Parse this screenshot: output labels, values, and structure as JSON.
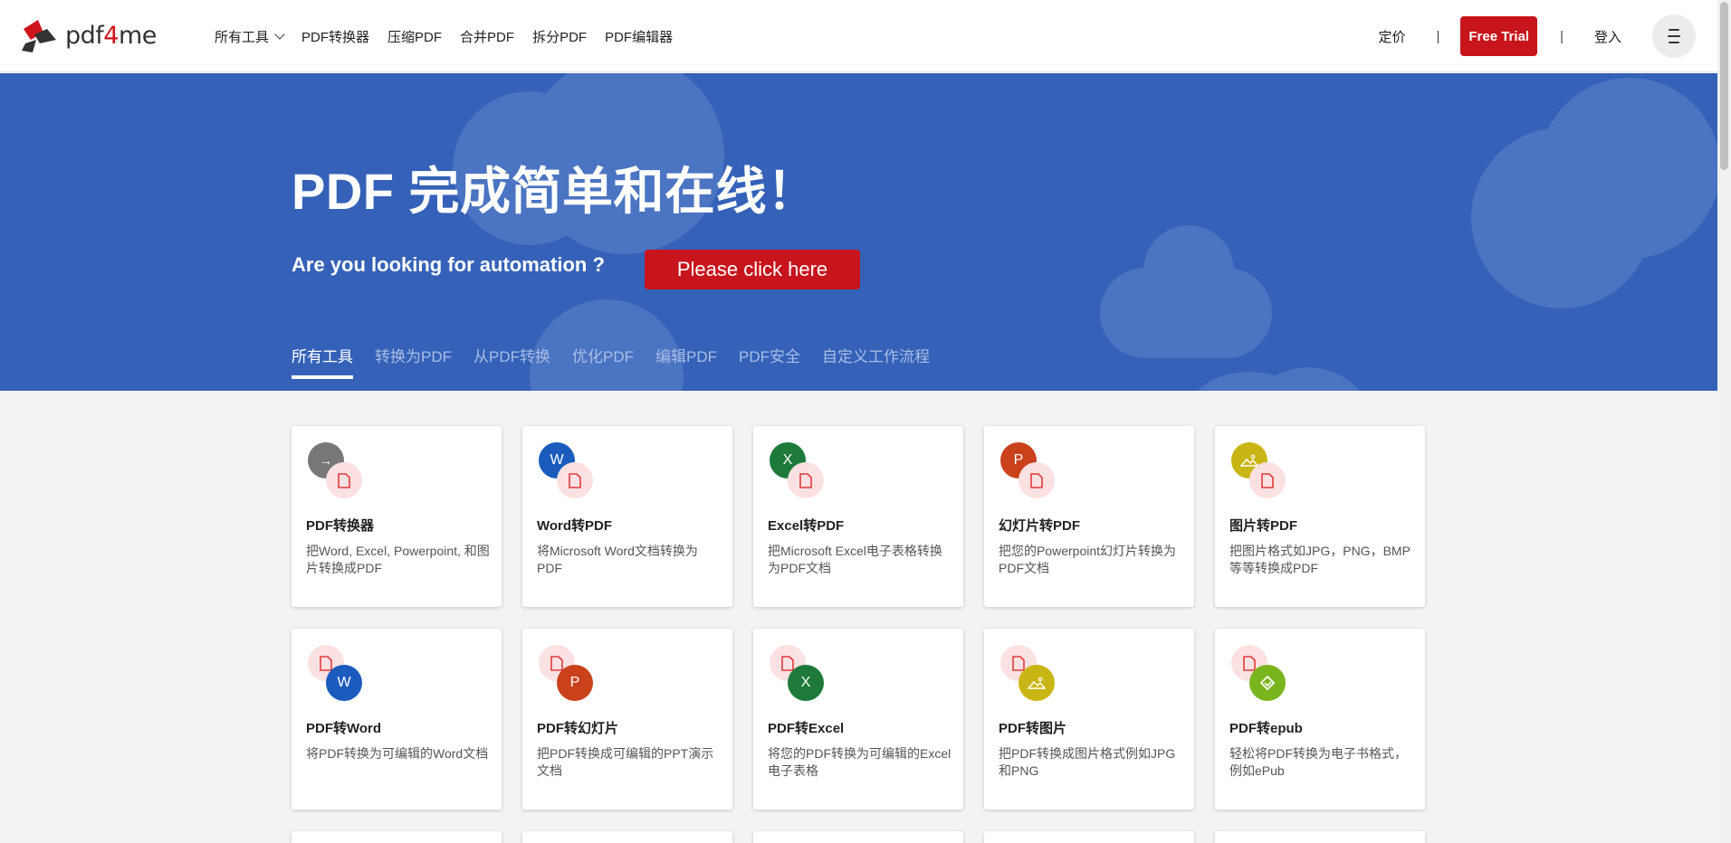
{
  "header": {
    "logo_text_a": "pdf",
    "logo_text_b": "4",
    "logo_text_c": "me",
    "nav": [
      {
        "label": "所有工具",
        "dropdown": true
      },
      {
        "label": "PDF转换器"
      },
      {
        "label": "压缩PDF"
      },
      {
        "label": "合并PDF"
      },
      {
        "label": "拆分PDF"
      },
      {
        "label": "PDF编辑器"
      }
    ],
    "pricing": "定价",
    "separator": "|",
    "trial": "Free Trial",
    "login": "登入"
  },
  "hero": {
    "title": "PDF 完成简单和在线！",
    "subtitle": "Are you looking for automation ?",
    "cta": "Please click here",
    "tabs": [
      "所有工具",
      "转换为PDF",
      "从PDF转换",
      "优化PDF",
      "编辑PDF",
      "PDF安全",
      "自定义工作流程"
    ],
    "active_tab": 0
  },
  "cards": [
    {
      "title": "PDF转换器",
      "desc": "把Word, Excel, Powerpoint, 和图片转换成PDF",
      "icon": "arrow-icon",
      "icon_glyph": "→",
      "color": "#777777"
    },
    {
      "title": "Word转PDF",
      "desc": "将Microsoft Word文档转换为PDF",
      "icon": "word-icon",
      "icon_glyph": "W",
      "color": "#1b5bbd"
    },
    {
      "title": "Excel转PDF",
      "desc": "把Microsoft Excel电子表格转换为PDF文档",
      "icon": "excel-icon",
      "icon_glyph": "X",
      "color": "#1e7a3a"
    },
    {
      "title": "幻灯片转PDF",
      "desc": "把您的Powerpoint幻灯片转换为PDF文档",
      "icon": "powerpoint-icon",
      "icon_glyph": "P",
      "color": "#c9421c"
    },
    {
      "title": "图片转PDF",
      "desc": "把图片格式如JPG，PNG，BMP等等转换成PDF",
      "icon": "image-icon",
      "icon_glyph": "",
      "color": "#c9b614"
    },
    {
      "title": "PDF转Word",
      "desc": "将PDF转换为可编辑的Word文档",
      "icon": "word-icon",
      "icon_glyph": "W",
      "color": "#1b5bbd"
    },
    {
      "title": "PDF转幻灯片",
      "desc": "把PDF转换成可编辑的PPT演示文档",
      "icon": "powerpoint-icon",
      "icon_glyph": "P",
      "color": "#c9421c"
    },
    {
      "title": "PDF转Excel",
      "desc": "将您的PDF转换为可编辑的Excel电子表格",
      "icon": "excel-icon",
      "icon_glyph": "X",
      "color": "#1e7a3a"
    },
    {
      "title": "PDF转图片",
      "desc": "把PDF转换成图片格式例如JPG和PNG",
      "icon": "image-icon",
      "icon_glyph": "",
      "color": "#c9b614"
    },
    {
      "title": "PDF转epub",
      "desc": "轻松将PDF转换为电子书格式，例如ePub",
      "icon": "epub-icon",
      "icon_glyph": "",
      "color": "#7ab51d"
    }
  ],
  "colors": {
    "brand_red": "#c8141c",
    "hero_blue": "#3562b8",
    "pdf_icon_bg": "#fbe1e2"
  }
}
